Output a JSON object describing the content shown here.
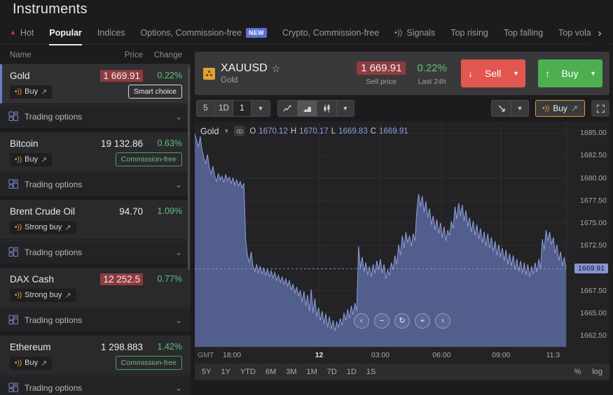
{
  "header": {
    "title": "Instruments"
  },
  "tabs": [
    {
      "label": "Hot",
      "icon": "flame-icon",
      "active": false
    },
    {
      "label": "Popular",
      "active": true
    },
    {
      "label": "Indices",
      "active": false
    },
    {
      "label": "Options, Commission-free",
      "badge": "NEW",
      "active": false
    },
    {
      "label": "Crypto, Commission-free",
      "active": false
    },
    {
      "label": "Signals",
      "icon": "signal-icon",
      "active": false
    },
    {
      "label": "Top rising",
      "active": false
    },
    {
      "label": "Top falling",
      "active": false
    },
    {
      "label": "Top volatility",
      "active": false
    }
  ],
  "tab_overflow_icon": "chevron-right-icon",
  "list": {
    "columns": {
      "name": "Name",
      "price": "Price",
      "change": "Change"
    },
    "trading_options_label": "Trading options",
    "rows": [
      {
        "name": "Gold",
        "price": "1 669.91",
        "price_highlight": true,
        "change": "0.22%",
        "signal": "Buy",
        "badge": "Smart choice",
        "badge_kind": "smart",
        "selected": true
      },
      {
        "name": "Bitcoin",
        "price": "19 132.86",
        "price_highlight": false,
        "change": "0.63%",
        "signal": "Buy",
        "badge": "Commission-free",
        "badge_kind": "green",
        "selected": false
      },
      {
        "name": "Brent Crude Oil",
        "price": "94.70",
        "price_highlight": false,
        "change": "1.09%",
        "signal": "Strong buy",
        "badge": "",
        "badge_kind": "none",
        "selected": false
      },
      {
        "name": "DAX Cash",
        "price": "12 252.5",
        "price_highlight": true,
        "change": "0.77%",
        "signal": "Strong buy",
        "badge": "",
        "badge_kind": "none",
        "selected": false
      },
      {
        "name": "Ethereum",
        "price": "1 298.883",
        "price_highlight": false,
        "change": "1.42%",
        "signal": "Buy",
        "badge": "Commission-free",
        "badge_kind": "green",
        "selected": false
      }
    ]
  },
  "instrument": {
    "symbol": "XAUUSD",
    "subtitle": "Gold",
    "price": "1 669.91",
    "price_label": "Sell price",
    "change": "0.22%",
    "change_label": "Last 24h",
    "sell_button": "Sell",
    "buy_button": "Buy",
    "star_icon": "star-outline-icon"
  },
  "toolbar": {
    "timeframes": [
      {
        "label": "5",
        "active": false
      },
      {
        "label": "1D",
        "active": false
      },
      {
        "label": "1",
        "active": true
      }
    ],
    "chart_types": [
      {
        "icon": "line-chart-icon",
        "active": false
      },
      {
        "icon": "area-chart-icon",
        "active": true
      },
      {
        "icon": "candlestick-chart-icon",
        "active": false
      }
    ],
    "cursor_tool_icon": "arrow-cursor-icon",
    "signal_button": "Buy",
    "fullscreen_icon": "fullscreen-icon"
  },
  "chart_data": {
    "type": "area",
    "title": "Gold",
    "symbol_label": "Gold",
    "ohlc": {
      "O": "1670.12",
      "H": "1670.17",
      "L": "1669.83",
      "C": "1669.91"
    },
    "ohlc_keys": {
      "o": "O",
      "h": "H",
      "l": "L",
      "c": "C"
    },
    "xlabel": "",
    "ylabel": "",
    "timezone": "GMT",
    "ylim": [
      1661.25,
      1686.25
    ],
    "yticks": [
      1685.0,
      1682.5,
      1680.0,
      1677.5,
      1675.0,
      1672.5,
      1667.5,
      1665.0,
      1662.5
    ],
    "ytick_labels": [
      "1685.00",
      "1682.50",
      "1680.00",
      "1677.50",
      "1675.00",
      "1672.50",
      "1667.50",
      "1665.00",
      "1662.50"
    ],
    "current_price": 1669.91,
    "current_price_label": "1669.91",
    "xticks": [
      {
        "label": "18:00",
        "pos": 0.1,
        "bold": false
      },
      {
        "label": "12",
        "pos": 0.335,
        "bold": true
      },
      {
        "label": "03:00",
        "pos": 0.5,
        "bold": false
      },
      {
        "label": "06:00",
        "pos": 0.665,
        "bold": false
      },
      {
        "label": "09:00",
        "pos": 0.825,
        "bold": false
      },
      {
        "label": "11:3",
        "pos": 0.965,
        "bold": false
      }
    ],
    "grid": true,
    "series_color": "#525f8c",
    "values": [
      1684.9,
      1684.2,
      1683.4,
      1684.6,
      1683.1,
      1682.2,
      1681.6,
      1682.6,
      1681.2,
      1680.4,
      1681.3,
      1680.2,
      1679.6,
      1680.5,
      1679.8,
      1680.2,
      1679.5,
      1680.4,
      1679.7,
      1680.1,
      1679.4,
      1680.0,
      1679.2,
      1679.8,
      1679.1,
      1679.6,
      1678.9,
      1679.4,
      1673.0,
      1671.4,
      1670.6,
      1671.8,
      1670.2,
      1669.6,
      1670.4,
      1669.4,
      1670.2,
      1669.3,
      1670.0,
      1669.2,
      1669.9,
      1669.0,
      1669.7,
      1668.9,
      1669.5,
      1668.6,
      1669.2,
      1668.4,
      1669.0,
      1668.2,
      1668.8,
      1668.0,
      1668.6,
      1667.6,
      1668.2,
      1667.2,
      1667.9,
      1666.9,
      1667.5,
      1666.2,
      1667.4,
      1665.8,
      1667.0,
      1665.2,
      1667.6,
      1665.0,
      1666.6,
      1664.6,
      1665.6,
      1664.2,
      1665.2,
      1663.8,
      1664.9,
      1663.4,
      1664.6,
      1663.2,
      1664.2,
      1663.0,
      1664.0,
      1663.4,
      1664.4,
      1663.6,
      1665.0,
      1664.2,
      1665.4,
      1664.4,
      1665.8,
      1664.8,
      1666.1,
      1665.2,
      1672.4,
      1670.0,
      1671.2,
      1669.6,
      1670.6,
      1669.2,
      1670.2,
      1669.0,
      1670.4,
      1669.4,
      1670.8,
      1669.8,
      1671.0,
      1669.4,
      1670.4,
      1668.8,
      1669.8,
      1669.2,
      1670.6,
      1669.8,
      1671.4,
      1670.4,
      1672.6,
      1671.4,
      1673.6,
      1672.2,
      1674.0,
      1672.8,
      1673.6,
      1672.4,
      1673.8,
      1673.0,
      1676.4,
      1678.2,
      1676.8,
      1678.0,
      1676.2,
      1677.4,
      1675.6,
      1676.6,
      1674.8,
      1675.8,
      1674.2,
      1675.4,
      1673.8,
      1675.0,
      1673.4,
      1674.6,
      1673.0,
      1674.2,
      1673.6,
      1675.2,
      1674.4,
      1676.8,
      1675.4,
      1677.2,
      1675.8,
      1677.0,
      1675.2,
      1676.4,
      1674.6,
      1675.6,
      1674.0,
      1675.2,
      1673.6,
      1674.8,
      1673.2,
      1674.4,
      1672.8,
      1674.0,
      1672.4,
      1673.8,
      1672.2,
      1673.4,
      1671.8,
      1673.0,
      1671.4,
      1672.6,
      1671.2,
      1672.2,
      1670.8,
      1672.0,
      1670.4,
      1671.6,
      1670.2,
      1671.4,
      1669.8,
      1671.0,
      1669.6,
      1670.8,
      1669.4,
      1670.6,
      1669.2,
      1670.4,
      1669.0,
      1670.2,
      1669.3,
      1670.6,
      1669.5,
      1671.0,
      1669.9,
      1673.2,
      1672.0,
      1674.2,
      1673.0,
      1674.0,
      1672.6,
      1673.4,
      1671.6,
      1672.6,
      1670.8,
      1671.8,
      1670.2,
      1671.2,
      1669.9
    ]
  },
  "nav_buttons": [
    {
      "icon": "chevron-left-icon",
      "label": "‹"
    },
    {
      "icon": "zoom-out-icon",
      "label": "−"
    },
    {
      "icon": "reset-icon",
      "label": "↻"
    },
    {
      "icon": "zoom-in-icon",
      "label": "+"
    },
    {
      "icon": "chevron-right-icon",
      "label": "›"
    }
  ],
  "ranges": [
    "5Y",
    "1Y",
    "YTD",
    "6M",
    "3M",
    "1M",
    "7D",
    "1D",
    "1S"
  ],
  "range_right": [
    "%",
    "log"
  ]
}
